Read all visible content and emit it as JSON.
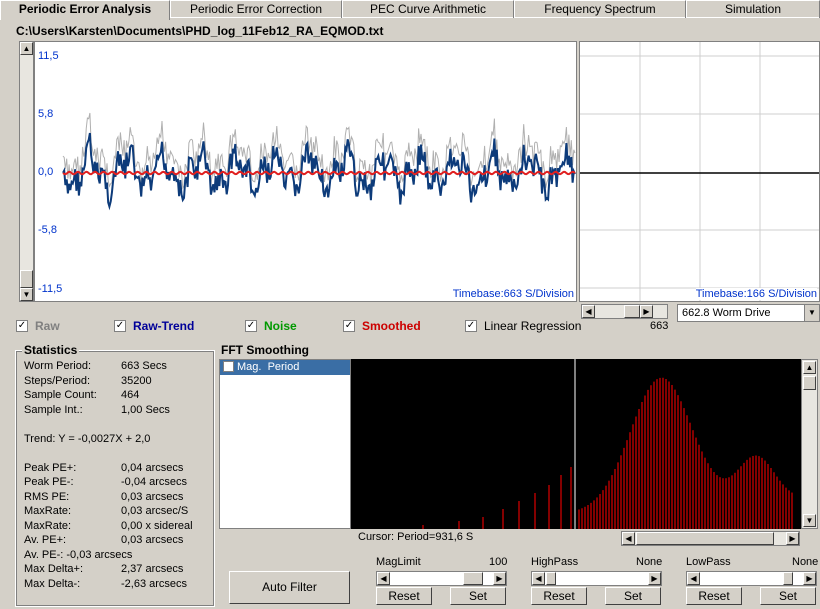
{
  "tabs": [
    {
      "label": "Periodic Error Analysis",
      "active": true
    },
    {
      "label": "Periodic Error Correction",
      "active": false
    },
    {
      "label": "PEC Curve Arithmetic",
      "active": false
    },
    {
      "label": "Frequency Spectrum",
      "active": false
    },
    {
      "label": "Simulation",
      "active": false
    }
  ],
  "file_path": "C:\\Users\\Karsten\\Documents\\PHD_log_11Feb12_RA_EQMOD.txt",
  "main_chart": {
    "y_ticks": [
      "11,5",
      "5,8",
      "0,0",
      "-5,8",
      "-11,5"
    ],
    "timebase": "Timebase:663 S/Division"
  },
  "side_chart": {
    "timebase": "Timebase:166 S/Division",
    "scroll_value": "663",
    "worm_drive": "662.8 Worm Drive"
  },
  "checkboxes": [
    {
      "label": "Raw",
      "checked": true,
      "color": "#808080"
    },
    {
      "label": "Raw-Trend",
      "checked": true,
      "color": "#000099"
    },
    {
      "label": "Noise",
      "checked": true,
      "color": "#009900"
    },
    {
      "label": "Smoothed",
      "checked": true,
      "color": "#cc0000"
    },
    {
      "label": "Linear Regression",
      "checked": true,
      "color": "#000000"
    }
  ],
  "statistics": {
    "title": "Statistics",
    "rows": [
      {
        "label": "Worm Period:",
        "value": "663 Secs"
      },
      {
        "label": "Steps/Period:",
        "value": "35200"
      },
      {
        "label": "Sample Count:",
        "value": "464"
      },
      {
        "label": "Sample Int.:",
        "value": "1,00 Secs"
      }
    ],
    "trend": "Trend: Y = -0,0027X + 2,0",
    "pe_rows": [
      {
        "label": "Peak PE+:",
        "value": "0,04 arcsecs"
      },
      {
        "label": "Peak PE-:",
        "value": "-0,04 arcsecs"
      },
      {
        "label": "RMS PE:",
        "value": "0,03 arcsecs"
      },
      {
        "label": "MaxRate:",
        "value": "0,03 arcsec/S"
      },
      {
        "label": "MaxRate:",
        "value": "0,00 x sidereal"
      },
      {
        "label": "Av. PE+:",
        "value": "0,03 arcsecs"
      }
    ],
    "av_pe_minus": "Av. PE-:  -0,03 arcsecs",
    "delta_rows": [
      {
        "label": "Max Delta+:",
        "value": "2,37 arcsecs"
      },
      {
        "label": "Max Delta-:",
        "value": "-2,63 arcsecs"
      }
    ]
  },
  "fft": {
    "title": "FFT Smoothing",
    "list_header": "Mag.  Period",
    "cursor": "Cursor: Period=931,6 S"
  },
  "filters": {
    "auto_filter": "Auto Filter",
    "maglimit": {
      "label": "MagLimit",
      "value": "100"
    },
    "highpass": {
      "label": "HighPass",
      "value": "None"
    },
    "lowpass": {
      "label": "LowPass",
      "value": "None"
    },
    "reset": "Reset",
    "set": "Set"
  },
  "colors": {
    "raw": "#b0b0b0",
    "trend": "#0d3b7a",
    "smoothed": "#e02020",
    "fft_bars": "#cc0000"
  }
}
